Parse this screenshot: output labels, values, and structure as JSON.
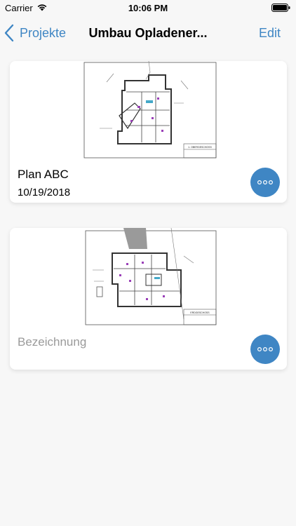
{
  "status_bar": {
    "carrier": "Carrier",
    "time": "10:06 PM",
    "icons": [
      "wifi-icon",
      "battery-icon"
    ]
  },
  "nav": {
    "back_label": "Projekte",
    "title": "Umbau Opladener...",
    "edit_label": "Edit"
  },
  "plans": [
    {
      "title": "Plan ABC",
      "date": "10/19/2018",
      "thumb_label": "1. OBERGESCHOSS"
    },
    {
      "title": "Bezeichnung",
      "date": "",
      "thumb_label": "ERDGESCHOSS"
    }
  ],
  "colors": {
    "accent": "#3f86c4",
    "background": "#f7f7f7",
    "card": "#ffffff",
    "placeholder_text": "#9a9a9a"
  }
}
